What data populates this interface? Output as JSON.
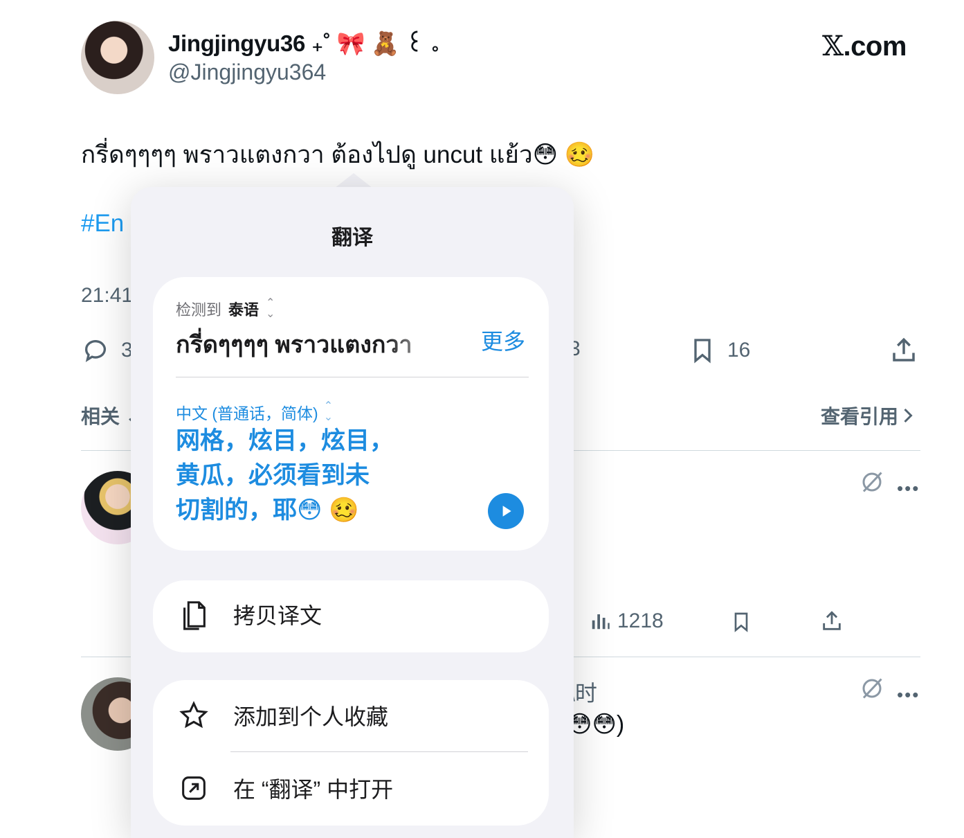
{
  "author": {
    "name": "Jingjingyu36 ₊˚ 🎀 🧸 ꒰ ｡",
    "handle": "@Jingjingyu364"
  },
  "brand": {
    "x": "𝕏",
    "rest": ".com"
  },
  "tweet": {
    "text": "กรี่ดๆๆๆๆ พราวแตงกวา ต้องไปดู uncut แย้ว😳 🥴",
    "hashtag": "#En",
    "timestamp": "21:41",
    "reply_count_partial": "3",
    "hidden_count_partial": "3",
    "bookmark_count": "16"
  },
  "related": {
    "label": "相关 ⌄",
    "view_quotes": "查看引用"
  },
  "replies": [
    {
      "views": "1218"
    },
    {
      "time_partial": "\\时",
      "text_partial": "😳😳)"
    }
  ],
  "translate_popup": {
    "title": "翻译",
    "detected_prefix": "检测到",
    "detected_language": "泰语",
    "source_text": "กรี่ดๆๆๆๆ พราวแตงกวา",
    "more_label": "更多",
    "target_language": "中文 (普通话，简体)",
    "translated_lines": [
      "网格，炫目，炫目，",
      "黄瓜，必须看到未",
      "切割的，耶😳 🥴"
    ],
    "copy_label": "拷贝译文",
    "favorite_label": "添加到个人收藏",
    "open_label": "在 “翻译” 中打开"
  },
  "colors": {
    "accent_blue": "#1d8ce0",
    "twitter_blue": "#1d9bf0",
    "muted_text": "#536471",
    "popup_bg": "#f2f2f7"
  }
}
